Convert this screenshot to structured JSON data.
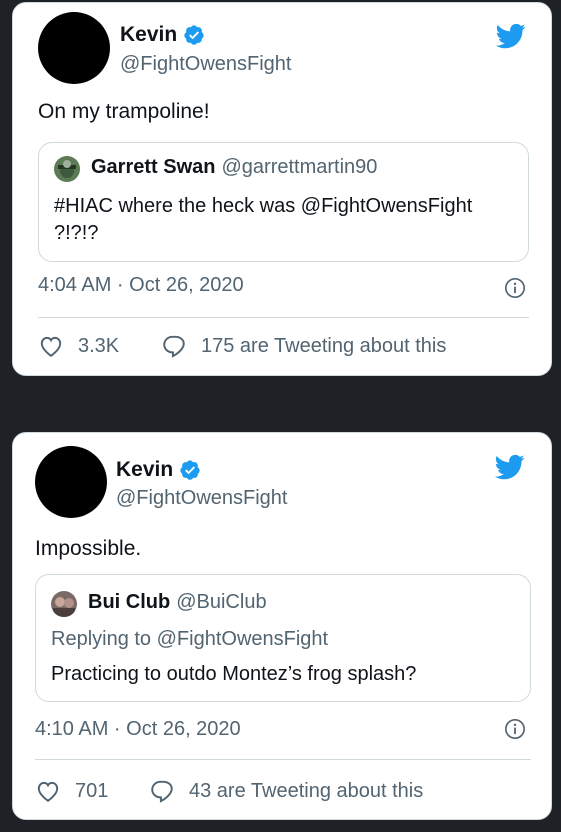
{
  "tweets": [
    {
      "author_name": "Kevin",
      "author_handle": "@FightOwensFight",
      "text": "On my trampoline!",
      "quote": {
        "name": "Garrett Swan",
        "handle": "@garrettmartin90",
        "line1": "#HIAC where the heck was @FightOwensFight",
        "line2": "?!?!?"
      },
      "timestamp": "4:04 AM · Oct 26, 2020",
      "likes": "3.3K",
      "tweeting": "175 are Tweeting about this"
    },
    {
      "author_name": "Kevin",
      "author_handle": "@FightOwensFight",
      "text": "Impossible.",
      "quote": {
        "name": "Bui Club",
        "handle": "@BuiClub",
        "replying_prefix": "Replying to ",
        "replying_to": "@FightOwensFight",
        "line1": "Practicing to outdo Montez’s frog splash?"
      },
      "timestamp": "4:10 AM · Oct 26, 2020",
      "likes": "701",
      "tweeting": "43 are Tweeting about this"
    }
  ],
  "colors": {
    "background": "#1e2126",
    "twitter_blue": "#1d9bf0",
    "secondary_text": "#536471",
    "border": "#cfd9de"
  },
  "icons": [
    "verified-badge-icon",
    "twitter-bird-icon",
    "info-icon",
    "heart-icon",
    "reply-bubble-icon"
  ]
}
